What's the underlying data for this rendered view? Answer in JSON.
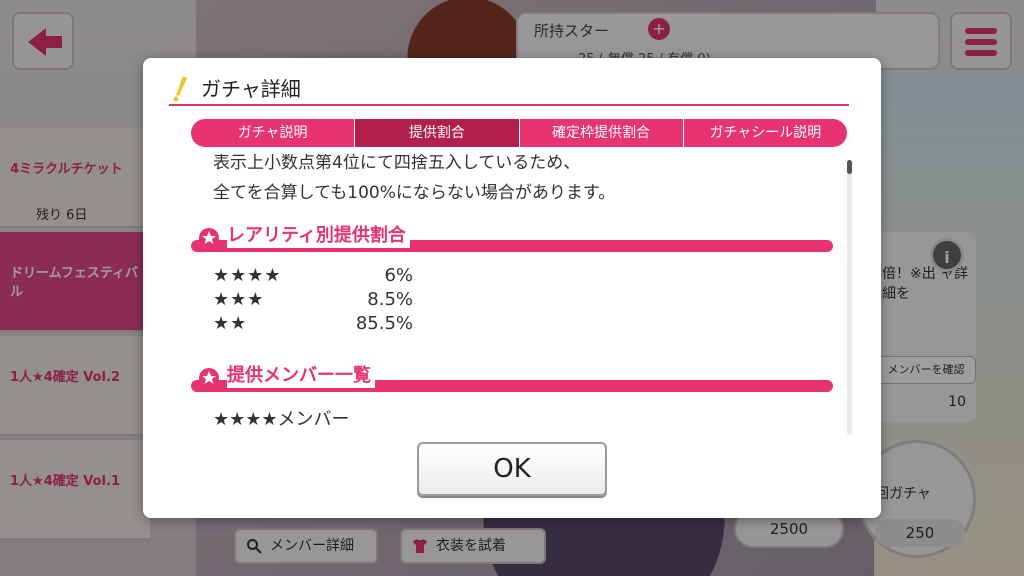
{
  "background": {
    "star_header_title": "所持スター",
    "star_header_plus": "+",
    "star_counts": "25 ( 無償 25 / 有償 0)",
    "side_items": [
      {
        "label": "4ミラクルチケット",
        "sub": "残り 6日"
      },
      {
        "label": "ドリームフェスティバル",
        "sub": ""
      },
      {
        "label": "1人★4確定 Vol.2",
        "sub": ""
      },
      {
        "label": "1人★4確定 Vol.1",
        "sub": ""
      }
    ],
    "right_panel_text": "倍！※出 ャ詳細を",
    "right_panel_button": "メンバーを確認",
    "right_panel_count": "10",
    "info_badge": "i",
    "big_circle_title": "回ガチャ",
    "big_circle_cost": "250",
    "cost_pill": "2500",
    "member_detail_button": "メンバー詳細",
    "costume_button": "衣装を試着"
  },
  "modal": {
    "title": "ガチャ詳細",
    "tabs": [
      {
        "label": "ガチャ説明",
        "active": false
      },
      {
        "label": "提供割合",
        "active": true
      },
      {
        "label": "確定枠提供割合",
        "active": false
      },
      {
        "label": "ガチャシール説明",
        "active": false
      }
    ],
    "notice_line1": "表示上小数点第4位にて四捨五入しているため、",
    "notice_line2": "全てを合算しても100%にならない場合があります。",
    "section1_title": "レアリティ別提供割合",
    "rates": [
      {
        "rarity": "★★★★",
        "value": "6%"
      },
      {
        "rarity": "★★★",
        "value": "8.5%"
      },
      {
        "rarity": "★★",
        "value": "85.5%"
      }
    ],
    "section2_title": "提供メンバー一覧",
    "member_group": "★★★★メンバー",
    "ok_label": "OK"
  },
  "colors": {
    "accent": "#e7336f",
    "tab_active": "#b21f4b"
  }
}
